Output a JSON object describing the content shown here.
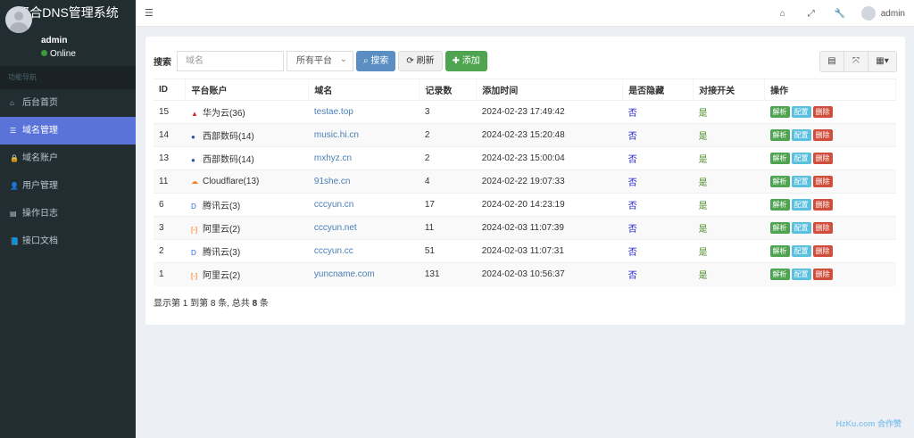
{
  "app": {
    "title": "聚合DNS管理系统"
  },
  "user": {
    "name": "admin",
    "status": "Online"
  },
  "sidebar": {
    "header": "功能导航",
    "items": [
      {
        "label": "后台首页",
        "icon": "home-icon"
      },
      {
        "label": "域名管理",
        "icon": "list-icon",
        "active": true
      },
      {
        "label": "域名账户",
        "icon": "lock-icon"
      },
      {
        "label": "用户管理",
        "icon": "user-icon"
      },
      {
        "label": "操作日志",
        "icon": "log-icon"
      },
      {
        "label": "接口文档",
        "icon": "book-icon"
      }
    ]
  },
  "header": {
    "username": "admin"
  },
  "toolbar": {
    "search_label": "搜索",
    "search_placeholder": "域名",
    "platform_select": "所有平台",
    "search_btn": "搜索",
    "refresh_btn": "刷新",
    "add_btn": "添加"
  },
  "table": {
    "columns": [
      "ID",
      "平台账户",
      "域名",
      "记录数",
      "添加时间",
      "是否隐藏",
      "对接开关",
      "操作"
    ],
    "actions": [
      "解析",
      "配置",
      "删除"
    ],
    "rows": [
      {
        "id": "15",
        "platform": "华为云(36)",
        "pcolor": "#d0302c",
        "pic": "▲",
        "domain": "testae.top",
        "records": "3",
        "time": "2024-02-23 17:49:42",
        "hidden": "否",
        "switch": "是"
      },
      {
        "id": "14",
        "platform": "西部数码(14)",
        "pcolor": "#2a5aa0",
        "pic": "●",
        "domain": "music.hi.cn",
        "records": "2",
        "time": "2024-02-23 15:20:48",
        "hidden": "否",
        "switch": "是"
      },
      {
        "id": "13",
        "platform": "西部数码(14)",
        "pcolor": "#2a5aa0",
        "pic": "●",
        "domain": "mxhyz.cn",
        "records": "2",
        "time": "2024-02-23 15:00:04",
        "hidden": "否",
        "switch": "是"
      },
      {
        "id": "11",
        "platform": "Cloudflare(13)",
        "pcolor": "#f38020",
        "pic": "☁",
        "domain": "91she.cn",
        "records": "4",
        "time": "2024-02-22 19:07:33",
        "hidden": "否",
        "switch": "是"
      },
      {
        "id": "6",
        "platform": "腾讯云(3)",
        "pcolor": "#2a6ae0",
        "pic": "D",
        "domain": "cccyun.cn",
        "records": "17",
        "time": "2024-02-20 14:23:19",
        "hidden": "否",
        "switch": "是"
      },
      {
        "id": "3",
        "platform": "阿里云(2)",
        "pcolor": "#ff6a00",
        "pic": "[-]",
        "domain": "cccyun.net",
        "records": "11",
        "time": "2024-02-03 11:07:39",
        "hidden": "否",
        "switch": "是"
      },
      {
        "id": "2",
        "platform": "腾讯云(3)",
        "pcolor": "#2a6ae0",
        "pic": "D",
        "domain": "cccyun.cc",
        "records": "51",
        "time": "2024-02-03 11:07:31",
        "hidden": "否",
        "switch": "是"
      },
      {
        "id": "1",
        "platform": "阿里云(2)",
        "pcolor": "#ff6a00",
        "pic": "[-]",
        "domain": "yuncname.com",
        "records": "131",
        "time": "2024-02-03 10:56:37",
        "hidden": "否",
        "switch": "是"
      }
    ]
  },
  "pager": {
    "pre": "显示第 1 到第 8 条, 总共 ",
    "total": "8",
    "post": " 条"
  },
  "watermark": "HzKu.com 合作赞"
}
